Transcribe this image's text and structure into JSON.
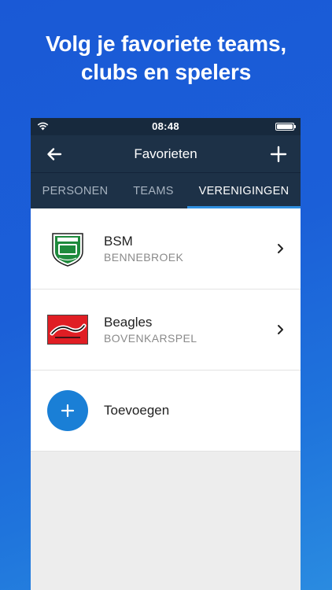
{
  "headline": {
    "line1": "Volg je favoriete teams,",
    "line2": "clubs en spelers"
  },
  "statusbar": {
    "time": "08:48",
    "icons": [
      "wifi-icon",
      "battery-icon"
    ]
  },
  "navbar": {
    "title": "Favorieten",
    "back_icon": "arrow-left-icon",
    "add_icon": "plus-icon"
  },
  "tabs": [
    {
      "label": "PERSONEN",
      "active": false
    },
    {
      "label": "TEAMS",
      "active": false
    },
    {
      "label": "VERENIGINGEN",
      "active": true
    }
  ],
  "clubs": [
    {
      "name": "BSM",
      "location": "BENNEBROEK",
      "logo": "bsm-logo"
    },
    {
      "name": "Beagles",
      "location": "BOVENKARSPEL",
      "logo": "beagles-logo"
    }
  ],
  "add_row": {
    "label": "Toevoegen",
    "icon": "plus-icon"
  },
  "colors": {
    "background": "#1b5fd8",
    "navbar": "#1d3147",
    "statusbar": "#17293d",
    "accent": "#1a7fd6",
    "tab_indicator": "#2f8fe0"
  }
}
